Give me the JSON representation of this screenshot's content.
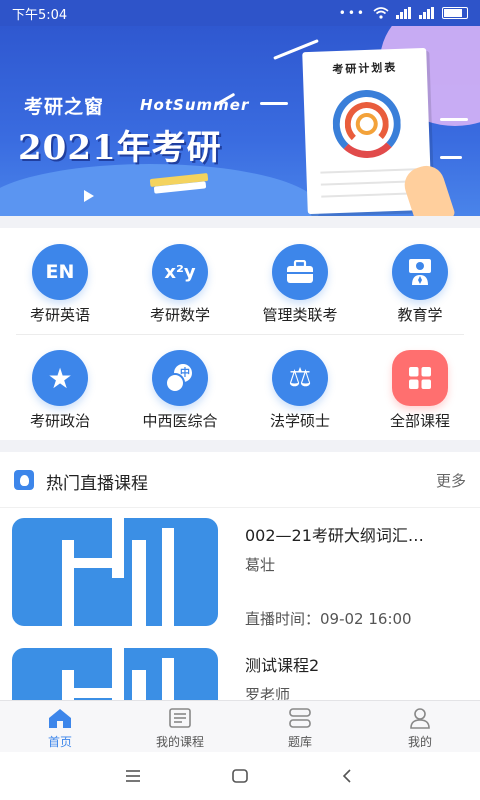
{
  "status_bar": {
    "time": "下午5:04",
    "dots": "•••"
  },
  "banner": {
    "brand": "考研之窗",
    "tagline": "HotSummer",
    "headline": "2021年考研",
    "paper_title": "考研计划表"
  },
  "categories": [
    {
      "label": "考研英语",
      "icon": "en-icon",
      "icon_text": "EN"
    },
    {
      "label": "考研数学",
      "icon": "math-icon",
      "icon_text": "x²y"
    },
    {
      "label": "管理类联考",
      "icon": "briefcase-icon",
      "icon_text": ""
    },
    {
      "label": "教育学",
      "icon": "teacher-icon",
      "icon_text": ""
    },
    {
      "label": "考研政治",
      "icon": "star-icon",
      "icon_text": "★"
    },
    {
      "label": "中西医综合",
      "icon": "chat-bubbles-icon",
      "icon_text": "中"
    },
    {
      "label": "法学硕士",
      "icon": "scales-icon",
      "icon_text": "⚖"
    },
    {
      "label": "全部课程",
      "icon": "grid-icon",
      "icon_text": ""
    }
  ],
  "live_section": {
    "title": "热门直播课程",
    "more": "更多",
    "courses": [
      {
        "title": "002—21考研大纲词汇…",
        "teacher": "葛壮",
        "time": "直播时间：09-02 16:00"
      },
      {
        "title": "测试课程2",
        "teacher": "罗老师",
        "time": ""
      }
    ]
  },
  "tabbar": {
    "tabs": [
      {
        "label": "首页",
        "icon": "home-icon",
        "active": true
      },
      {
        "label": "我的课程",
        "icon": "courses-icon",
        "active": false
      },
      {
        "label": "题库",
        "icon": "question-bank-icon",
        "active": false
      },
      {
        "label": "我的",
        "icon": "profile-icon",
        "active": false
      }
    ]
  },
  "colors": {
    "primary": "#3d86ea",
    "banner": "#2f58d0",
    "accent_red": "#ff6f6f"
  }
}
